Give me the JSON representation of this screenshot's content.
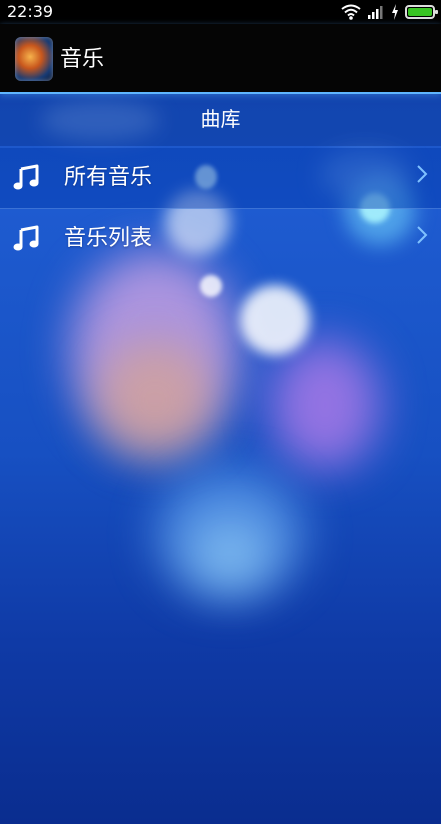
{
  "status_bar": {
    "time": "22:39",
    "icons": [
      "wifi-icon",
      "signal-icon",
      "charging-icon",
      "battery-icon"
    ],
    "battery_color": "#38c423"
  },
  "app_header": {
    "title": "音乐",
    "icon": "music-app-icon"
  },
  "library": {
    "title": "曲库",
    "items": [
      {
        "label": "所有音乐",
        "icon": "music-note-icon"
      },
      {
        "label": "音乐列表",
        "icon": "music-note-icon"
      }
    ]
  },
  "colors": {
    "background": "#1b4fc0",
    "header": "#050505",
    "header_accent": "#5fb6ff",
    "text": "#ffffff"
  }
}
